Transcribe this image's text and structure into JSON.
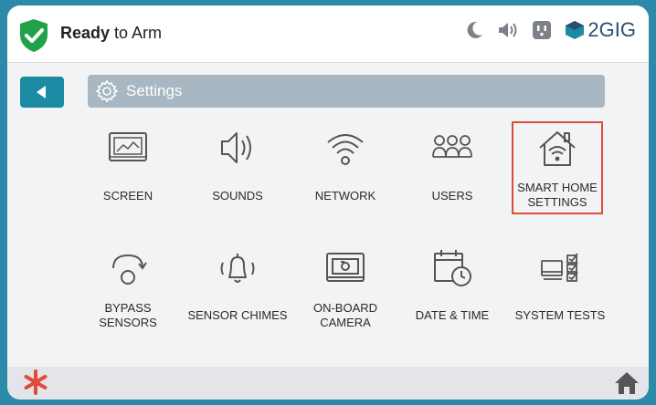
{
  "status": {
    "state_bold": "Ready",
    "state_rest": " to Arm",
    "brand": "2GIG"
  },
  "header": {
    "title": "Settings"
  },
  "tiles": [
    {
      "label": "SCREEN",
      "icon": "screen-icon"
    },
    {
      "label": "SOUNDS",
      "icon": "speaker-icon"
    },
    {
      "label": "NETWORK",
      "icon": "wifi-icon"
    },
    {
      "label": "USERS",
      "icon": "users-icon"
    },
    {
      "label": "SMART HOME\nSETTINGS",
      "icon": "smart-home-icon"
    },
    {
      "label": "BYPASS\nSENSORS",
      "icon": "bypass-icon"
    },
    {
      "label": "SENSOR CHIMES",
      "icon": "bell-icon"
    },
    {
      "label": "ON-BOARD\nCAMERA",
      "icon": "camera-icon"
    },
    {
      "label": "DATE & TIME",
      "icon": "calendar-clock-icon"
    },
    {
      "label": "SYSTEM TESTS",
      "icon": "checklist-icon"
    }
  ],
  "colors": {
    "accent": "#1b8aa3",
    "highlight": "#e04b3a",
    "shield": "#1fa24a",
    "title_bar": "#a8b7c1"
  }
}
